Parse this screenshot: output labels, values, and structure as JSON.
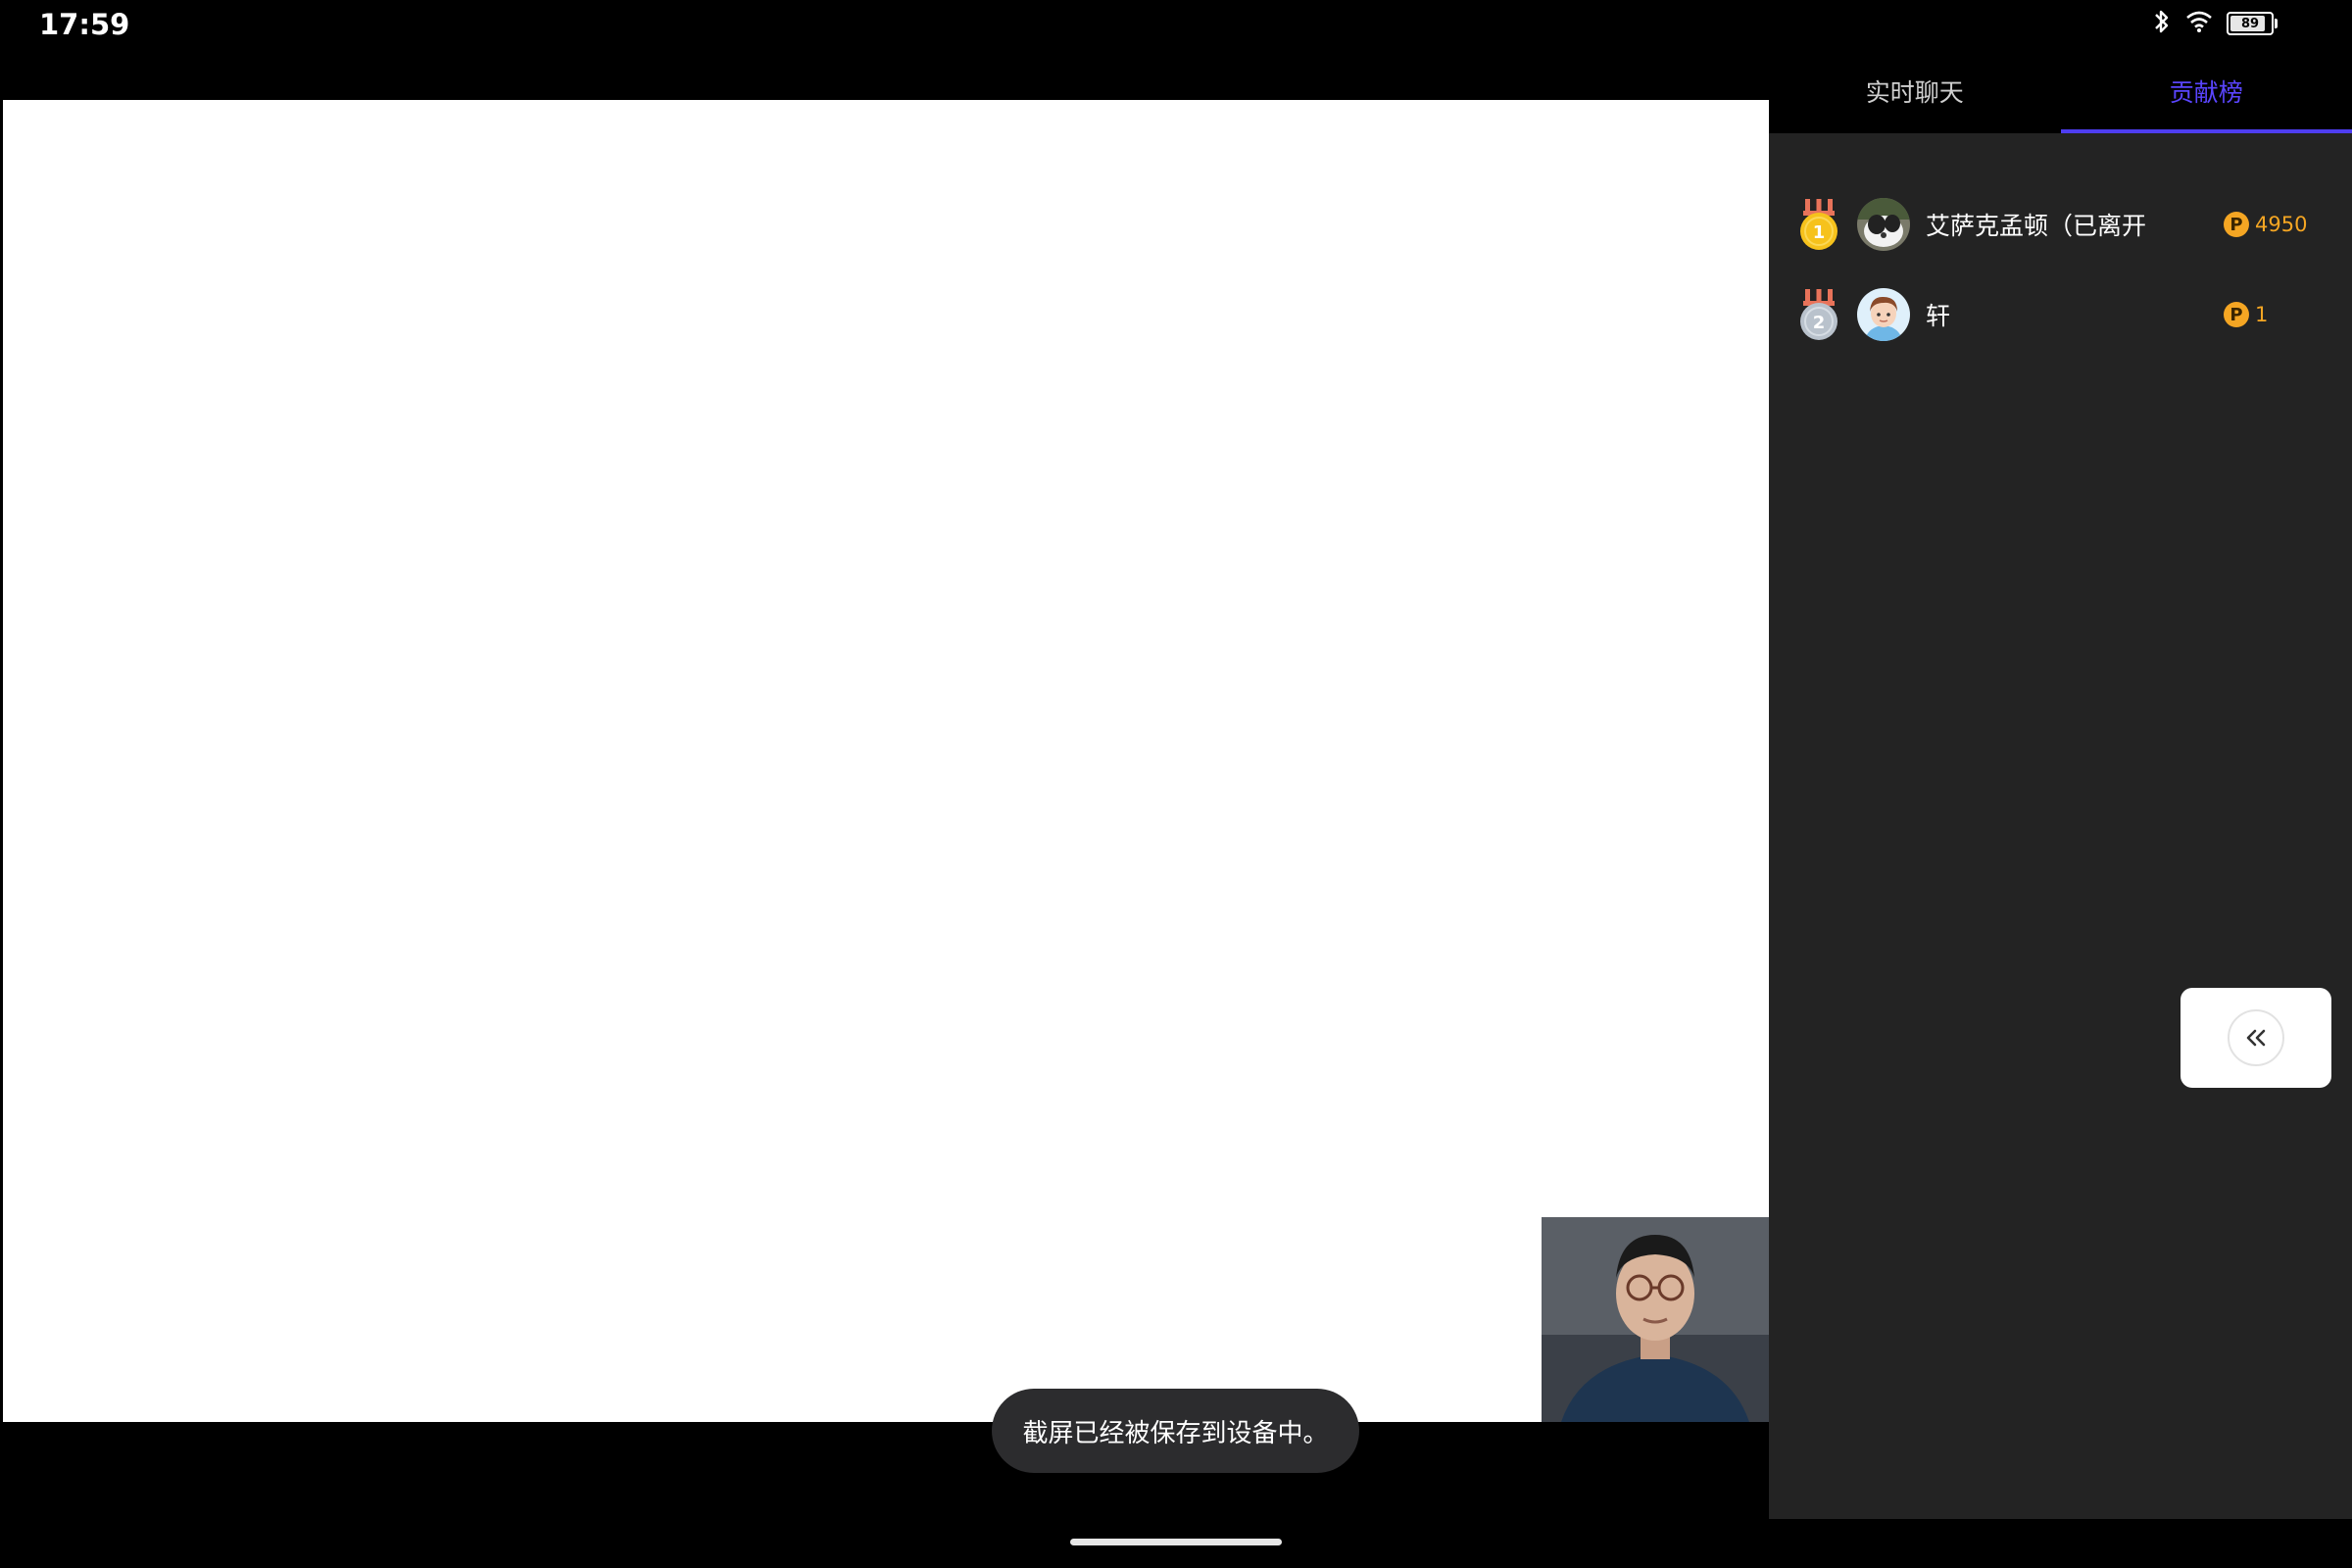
{
  "status_bar": {
    "time": "17:59",
    "battery_level": "89"
  },
  "tabs": [
    {
      "label": "实时聊天",
      "active": false
    },
    {
      "label": "贡献榜",
      "active": true
    }
  ],
  "ranking": [
    {
      "rank": "1",
      "name": "艾萨克孟顿（已离开",
      "points": "4950"
    },
    {
      "rank": "2",
      "name": "轩",
      "points": "1"
    }
  ],
  "coin_symbol": "P",
  "toast": "截屏已经被保存到设备中。",
  "colors": {
    "accent": "#4e3df0",
    "coin": "#f5a623",
    "panel": "#232323",
    "gold_medal": "#f6c21c",
    "silver_medal": "#b9c2cc"
  }
}
